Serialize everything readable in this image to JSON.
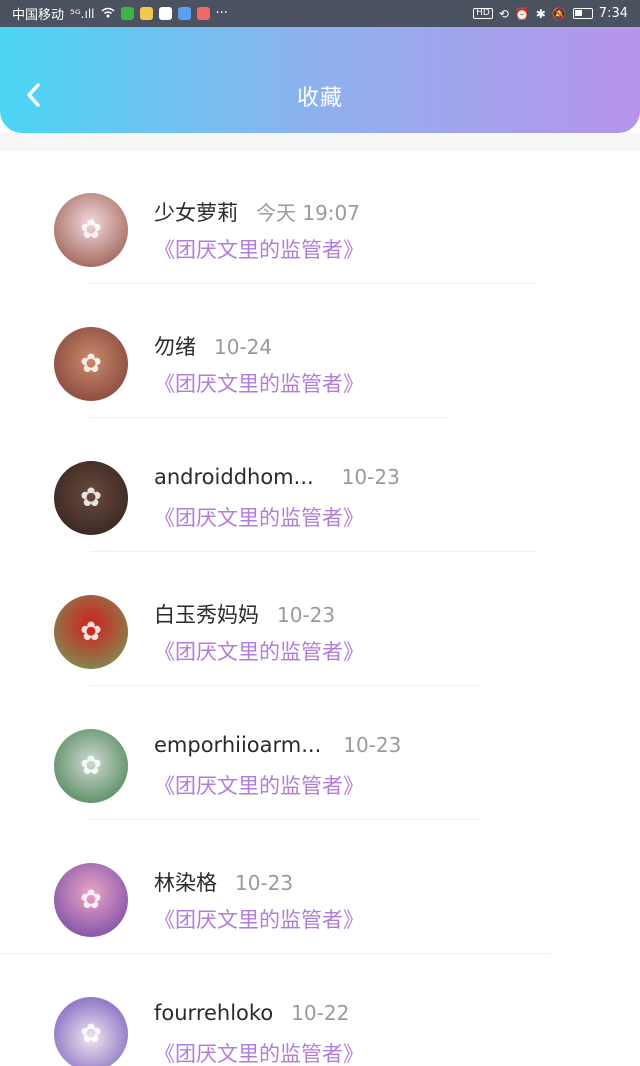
{
  "status_bar": {
    "carrier": "中国移动",
    "signal": "⁵ᴳ.ıll",
    "wifi": "wifi",
    "overflow": "···",
    "hd": "HD",
    "time": "7:34",
    "icons": [
      "wifi-icon",
      "app-icon-1",
      "app-icon-2",
      "app-icon-3",
      "app-icon-4",
      "app-icon-5",
      "hd-icon",
      "data-icon",
      "alarm-icon",
      "bluetooth-icon",
      "mute-icon",
      "battery-icon"
    ]
  },
  "header": {
    "title": "收藏",
    "back_icon": "chevron-left-icon",
    "gradient": [
      "#4bd5f5",
      "#8fb0ee",
      "#b794ec"
    ]
  },
  "items": [
    {
      "name": "少女萝莉",
      "time": "今天 19:07",
      "book": "《团厌文里的监管者》",
      "avatar_colors": [
        "#f4d7de",
        "#8d4d3c"
      ]
    },
    {
      "name": "勿绪",
      "time": "10-24",
      "book": "《团厌文里的监管者》",
      "avatar_colors": [
        "#c98a6a",
        "#7a3a36"
      ]
    },
    {
      "name": "androiddhom...",
      "time": "10-23",
      "book": "《团厌文里的监管者》",
      "avatar_colors": [
        "#6b4a3e",
        "#2b1f1c"
      ]
    },
    {
      "name": "白玉秀妈妈",
      "time": "10-23",
      "book": "《团厌文里的监管者》",
      "avatar_colors": [
        "#d11f1f",
        "#6fa35d"
      ]
    },
    {
      "name": "emporhiioarm...",
      "time": "10-23",
      "book": "《团厌文里的监管者》",
      "avatar_colors": [
        "#cfd9d4",
        "#3c7a45"
      ]
    },
    {
      "name": "林染格",
      "time": "10-23",
      "book": "《团厌文里的监管者》",
      "avatar_colors": [
        "#6a3fa0",
        "#e8a5c7"
      ]
    },
    {
      "name": "fourrehloko",
      "time": "10-22",
      "book": "《团厌文里的监管者》",
      "avatar_colors": [
        "#6b4fb8",
        "#f1e6ef"
      ]
    }
  ],
  "colors": {
    "accent_purple": "#b07ed8",
    "name_text": "#2a2a2a",
    "time_text": "#9a9a9a"
  }
}
